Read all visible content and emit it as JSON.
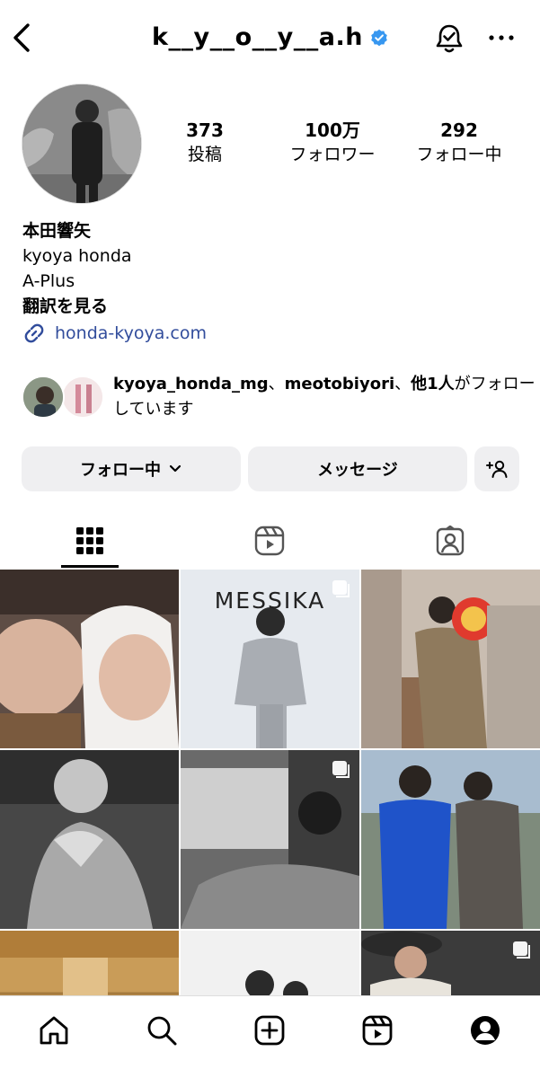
{
  "header": {
    "username": "k__y__o__y__a.h"
  },
  "stats": {
    "posts_count": "373",
    "posts_label": "投稿",
    "followers_count": "100万",
    "followers_label": "フォロワー",
    "following_count": "292",
    "following_label": "フォロー中"
  },
  "bio": {
    "name": "本田響矢",
    "line1": "kyoya honda",
    "line2": "A-Plus",
    "translate": "翻訳を見る",
    "link": "honda-kyoya.com"
  },
  "mutual": {
    "user1": "kyoya_honda_mg",
    "sep1": "、",
    "user2": "meotobiyori",
    "sep2": "、",
    "others": "他1人",
    "suffix": "がフォローしています"
  },
  "actions": {
    "following_label": "フォロー中",
    "message_label": "メッセージ"
  },
  "posts": {
    "messika_text": "MESSIKA"
  },
  "colors": {
    "verified": "#3797f0",
    "link": "#324d9c",
    "button_bg": "#efeff1"
  }
}
